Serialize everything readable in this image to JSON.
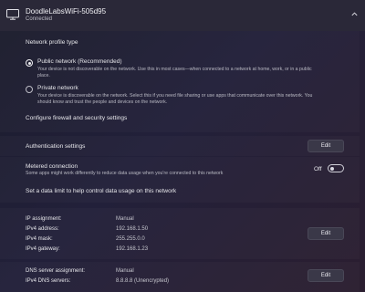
{
  "header": {
    "network_name": "DoodleLabsWiFi-505d95",
    "status": "Connected"
  },
  "profile": {
    "section_title": "Network profile type",
    "public_title": "Public network (Recommended)",
    "public_desc_1": "Your device is not discoverable on the network. Use this in most cases—when connected to a network at home, work, or in a public",
    "public_desc_2": "place.",
    "private_title": "Private network",
    "private_desc_1": "Your device is discoverable on the network. Select this if you need file sharing or use apps that communicate over this network. You",
    "private_desc_2": "should know and trust the people and devices on the network.",
    "selected": "public",
    "firewall_link": "Configure firewall and security settings"
  },
  "auth": {
    "label": "Authentication settings",
    "edit": "Edit"
  },
  "metered": {
    "title": "Metered connection",
    "desc": "Some apps might work differently to reduce data usage when you're connected to this network",
    "state": "Off",
    "on": false,
    "data_limit_link": "Set a data limit to help control data usage on this network"
  },
  "ip": {
    "rows": [
      {
        "key": "IP assignment:",
        "value": "Manual"
      },
      {
        "key": "IPv4 address:",
        "value": "192.168.1.50"
      },
      {
        "key": "IPv4 mask:",
        "value": "255.255.0.0"
      },
      {
        "key": "IPv4 gateway:",
        "value": "192.168.1.23"
      }
    ],
    "edit": "Edit"
  },
  "dns": {
    "rows": [
      {
        "key": "DNS server assignment:",
        "value": "Manual"
      },
      {
        "key": "IPv4 DNS servers:",
        "value": "8.8.8.8 (Unencrypted)"
      }
    ],
    "edit": "Edit"
  }
}
